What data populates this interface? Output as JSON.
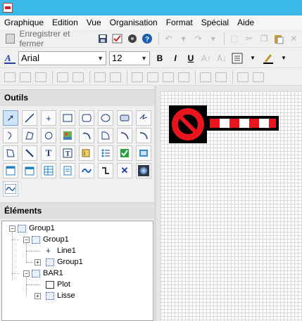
{
  "menu": [
    "Graphique",
    "Edition",
    "Vue",
    "Organisation",
    "Format",
    "Spécial",
    "Aide"
  ],
  "toolbar": {
    "save_close_label": "Enregistrer et fermer"
  },
  "format": {
    "font_name": "Arial",
    "font_size": "12",
    "bold_label": "B",
    "italic_label": "I",
    "underline_label": "U"
  },
  "panels": {
    "tools_title": "Outils",
    "elements_title": "Éléments"
  },
  "tree": {
    "group1": "Group1",
    "group1_child_group": "Group1",
    "line1": "Line1",
    "nested_group1": "Group1",
    "bar1": "BAR1",
    "plot": "Plot",
    "lisse": "Lisse"
  },
  "colors": {
    "titlebar": "#3ab8e8",
    "barrier_red": "#e8141e",
    "barrier_black": "#000000"
  },
  "icons": [
    "pointer-icon",
    "line-icon",
    "cross-icon",
    "rectangle-icon",
    "rounded-rect-icon",
    "ellipse-icon",
    "button-icon",
    "zigzag-icon",
    "curve-icon",
    "polygon-icon",
    "blob-icon",
    "image-icon",
    "arc-icon",
    "chord-icon",
    "pie-icon",
    "bezier-icon",
    "text-icon",
    "text-box-icon",
    "slider-icon",
    "list-icon",
    "checkbox-icon",
    "stamp-icon",
    "window-icon",
    "calendar-icon",
    "table-icon",
    "wave-icon",
    "step-line-icon",
    "x-mark-icon",
    "media-icon",
    "trend-icon"
  ]
}
